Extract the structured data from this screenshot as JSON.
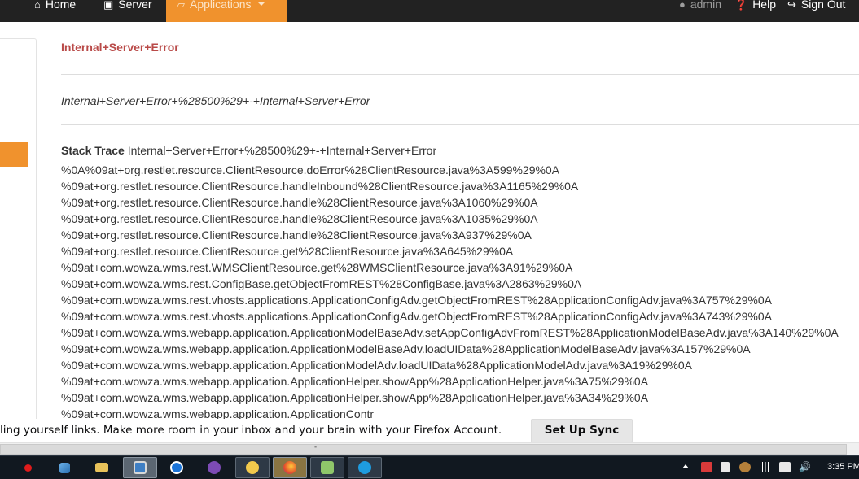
{
  "navbar": {
    "home_label": "Home",
    "server_label": "Server",
    "applications_label": "Applications",
    "admin_label": "admin",
    "help_label": "Help",
    "signout_label": "Sign Out",
    "accent_color": "#f0922d"
  },
  "error": {
    "title": "Internal+Server+Error",
    "message": "Internal+Server+Error+%28500%29+-+Internal+Server+Error",
    "stack_label": "Stack Trace",
    "stack_summary": "Internal+Server+Error+%28500%29+-+Internal+Server+Error",
    "stack_lines": [
      "%0A%09at+org.restlet.resource.ClientResource.doError%28ClientResource.java%3A599%29%0A",
      "%09at+org.restlet.resource.ClientResource.handleInbound%28ClientResource.java%3A1165%29%0A",
      "%09at+org.restlet.resource.ClientResource.handle%28ClientResource.java%3A1060%29%0A",
      "%09at+org.restlet.resource.ClientResource.handle%28ClientResource.java%3A1035%29%0A",
      "%09at+org.restlet.resource.ClientResource.handle%28ClientResource.java%3A937%29%0A",
      "%09at+org.restlet.resource.ClientResource.get%28ClientResource.java%3A645%29%0A",
      "%09at+com.wowza.wms.rest.WMSClientResource.get%28WMSClientResource.java%3A91%29%0A",
      "%09at+com.wowza.wms.rest.ConfigBase.getObjectFromREST%28ConfigBase.java%3A2863%29%0A",
      "%09at+com.wowza.wms.rest.vhosts.applications.ApplicationConfigAdv.getObjectFromREST%28ApplicationConfigAdv.java%3A757%29%0A",
      "%09at+com.wowza.wms.rest.vhosts.applications.ApplicationConfigAdv.getObjectFromREST%28ApplicationConfigAdv.java%3A743%29%0A",
      "%09at+com.wowza.wms.webapp.application.ApplicationModelBaseAdv.setAppConfigAdvFromREST%28ApplicationModelBaseAdv.java%3A140%29%0A",
      "%09at+com.wowza.wms.webapp.application.ApplicationModelBaseAdv.loadUIData%28ApplicationModelBaseAdv.java%3A157%29%0A",
      "%09at+com.wowza.wms.webapp.application.ApplicationModelAdv.loadUIData%28ApplicationModelAdv.java%3A19%29%0A",
      "%09at+com.wowza.wms.webapp.application.ApplicationHelper.showApp%28ApplicationHelper.java%3A75%29%0A",
      "%09at+com.wowza.wms.webapp.application.ApplicationHelper.showApp%28ApplicationHelper.java%3A34%29%0A",
      "%09at+com.wowza.wms.webapp.application.ApplicationContr"
    ]
  },
  "notification": {
    "text": "ling yourself links. Make more room in your inbox and your brain with your Firefox Account.",
    "button_label": "Set Up Sync"
  },
  "scrollbar": {
    "grip": "'''"
  },
  "taskbar": {
    "clock": "3:35 PM",
    "apps": [
      "media-player-icon",
      "network-tool-icon",
      "file-explorer-icon",
      "remote-desktop-icon",
      "teamviewer-icon",
      "viber-icon",
      "outlook-icon",
      "firefox-icon",
      "file-manager-icon",
      "skype-icon"
    ]
  }
}
